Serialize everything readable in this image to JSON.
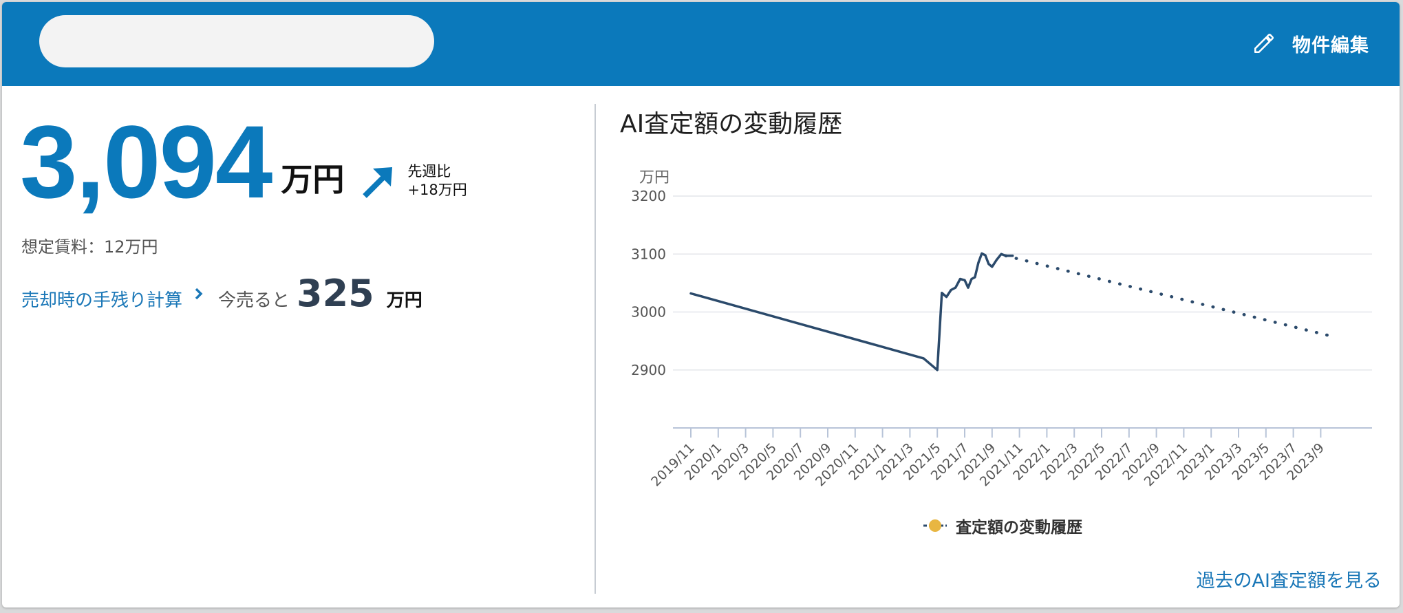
{
  "header": {
    "edit_label": "物件編集",
    "bg_color": "#0b79bb"
  },
  "summary": {
    "price": "3,094",
    "price_unit": "万円",
    "trend_label": "先週比",
    "trend_value": "+18万円",
    "rent": "想定賃料：12万円",
    "calc_link": "売却時の手残り計算",
    "sell_prefix": "今売ると",
    "sell_value": "325",
    "sell_unit": "万円"
  },
  "chart_panel": {
    "title": "AI査定額の変動履歴",
    "history_link": "過去のAI査定額を見る"
  },
  "chart_data": {
    "type": "line",
    "ylabel": "万円",
    "ylim": [
      2800,
      3200
    ],
    "yticks": [
      2900,
      3000,
      3100,
      3200
    ],
    "grid": true,
    "legend": "bottom",
    "x_ticks": [
      "2019/11",
      "2020/1",
      "2020/3",
      "2020/5",
      "2020/7",
      "2020/9",
      "2020/11",
      "2021/1",
      "2021/3",
      "2021/5",
      "2021/7",
      "2021/9",
      "2021/11",
      "2022/1",
      "2022/3",
      "2022/5",
      "2022/7",
      "2022/9",
      "2022/11",
      "2023/1",
      "2023/3",
      "2023/5",
      "2023/7",
      "2023/9"
    ],
    "series": [
      {
        "name": "査定額の変動履歴",
        "style": "solid",
        "color": "#2b4a6b",
        "marker_color": "#e8b642",
        "x": [
          "2019/11",
          "2021/4",
          "2021/5",
          "2021/5",
          "2021/5",
          "2021/6",
          "2021/6",
          "2021/6",
          "2021/7",
          "2021/7",
          "2021/7",
          "2021/7",
          "2021/8",
          "2021/8",
          "2021/8",
          "2021/8",
          "2021/9",
          "2021/9",
          "2021/9",
          "2021/10",
          "2021/10"
        ],
        "values": [
          3032,
          2920,
          2900,
          3033,
          3026,
          3038,
          3042,
          3057,
          3055,
          3042,
          3057,
          3060,
          3085,
          3101,
          3098,
          3083,
          3078,
          3090,
          3100,
          3097,
          3097
        ]
      },
      {
        "name": "",
        "style": "dotted",
        "color": "#2b4a6b",
        "x": [
          "2021/10",
          "2023/10"
        ],
        "values": [
          3097,
          2957
        ]
      }
    ]
  }
}
